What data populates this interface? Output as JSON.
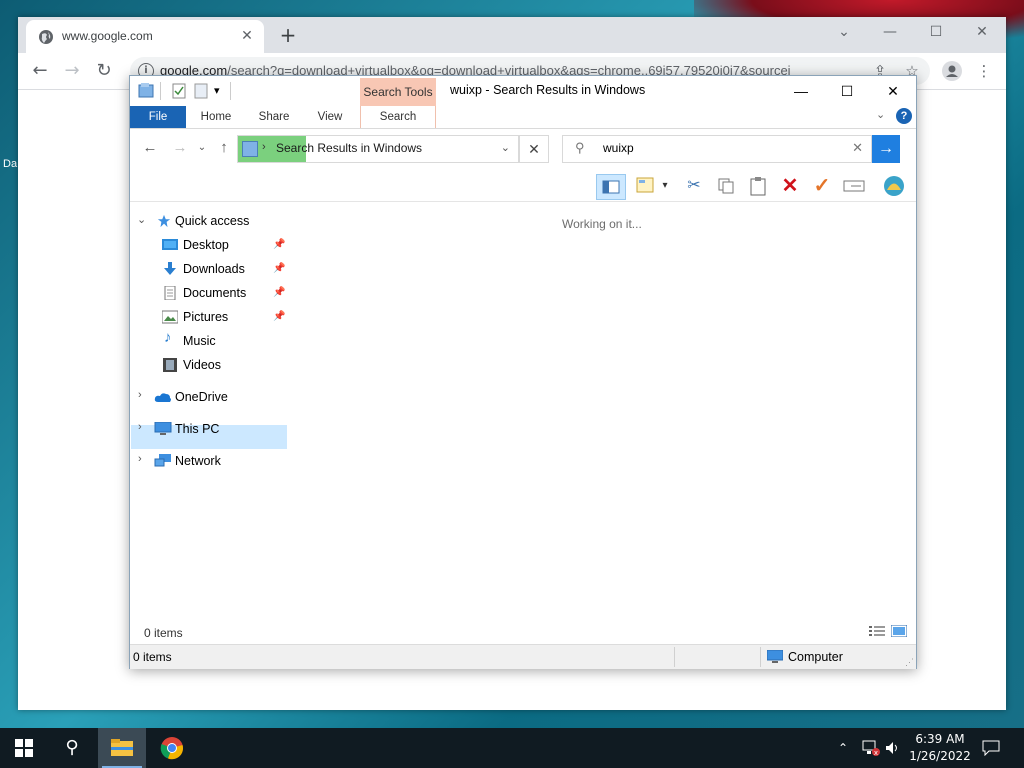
{
  "desktop": {
    "icon_label": "Da"
  },
  "chrome": {
    "tab_title": "www.google.com",
    "tab_close": "✕",
    "new_tab": "+",
    "url_host": "google.com",
    "url_rest": "/search?q=download+virtualbox&oq=download+virtualbox&aqs=chrome..69i57.79520j0j7&sourcei"
  },
  "explorer": {
    "title": "wuixp - Search Results in Windows",
    "context_tab": "Search Tools",
    "ribbon_tabs": [
      "File",
      "Home",
      "Share",
      "View",
      "Search"
    ],
    "address": "Search Results in Windows",
    "search_value": "wuixp",
    "working_text": "Working on it...",
    "items_count": "0 items",
    "status_items": "0 items",
    "status_location": "Computer",
    "nav": {
      "quick_access": "Quick access",
      "quick_items": [
        "Desktop",
        "Downloads",
        "Documents",
        "Pictures",
        "Music",
        "Videos"
      ],
      "onedrive": "OneDrive",
      "this_pc": "This PC",
      "network": "Network"
    }
  },
  "taskbar": {
    "time": "6:39 AM",
    "date": "1/26/2022"
  },
  "colors": {
    "accent": "#1a64b4",
    "context_tab": "#f8c7b4",
    "selection": "#cce8ff",
    "progress": "#7bd07e"
  }
}
